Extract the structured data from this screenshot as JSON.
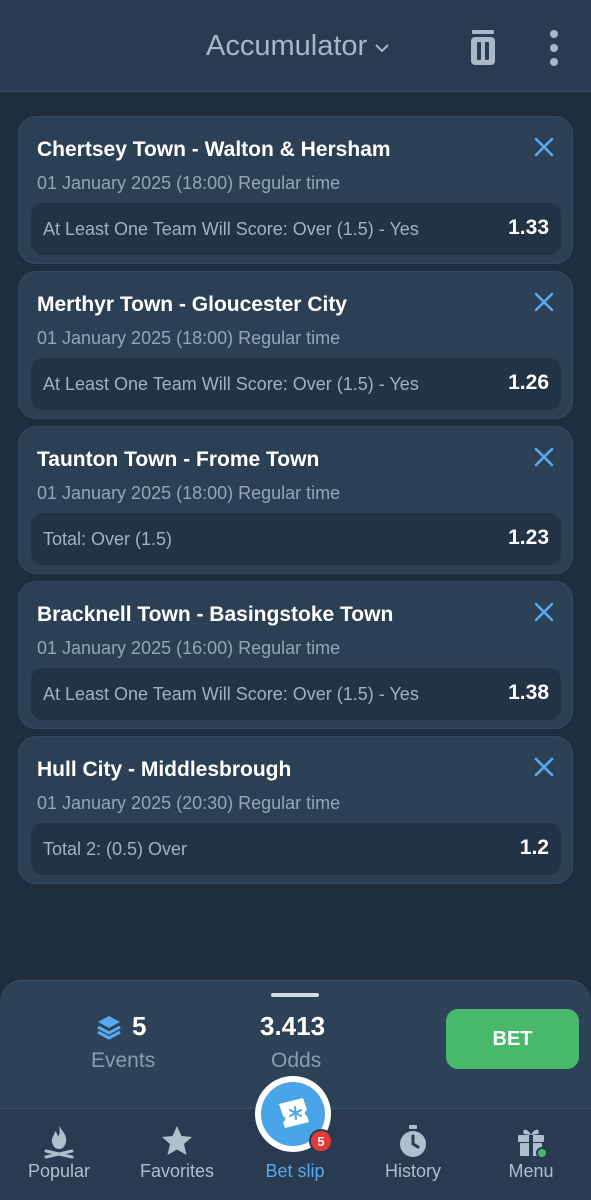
{
  "header": {
    "title": "Accumulator"
  },
  "bets": [
    {
      "match": "Chertsey Town - Walton & Hersham",
      "datetime": "01 January 2025 (18:00) Regular time",
      "market": "At Least One Team Will Score: Over (1.5) - Yes",
      "odds": "1.33"
    },
    {
      "match": "Merthyr Town - Gloucester City",
      "datetime": "01 January 2025 (18:00) Regular time",
      "market": "At Least One Team Will Score: Over (1.5) - Yes",
      "odds": "1.26"
    },
    {
      "match": "Taunton Town - Frome Town",
      "datetime": "01 January 2025 (18:00) Regular time",
      "market": "Total: Over (1.5)",
      "odds": "1.23"
    },
    {
      "match": "Bracknell Town - Basingstoke Town",
      "datetime": "01 January 2025 (16:00) Regular time",
      "market": "At Least One Team Will Score: Over (1.5) - Yes",
      "odds": "1.38"
    },
    {
      "match": "Hull City - Middlesbrough",
      "datetime": "01 January 2025 (20:30) Regular time",
      "market": "Total 2: (0.5) Over",
      "odds": "1.2"
    }
  ],
  "summary": {
    "events_count": "5",
    "events_label": "Events",
    "odds_value": "3.413",
    "odds_label": "Odds",
    "bet_label": "BET"
  },
  "nav": {
    "items": [
      {
        "label": "Popular",
        "icon": "campfire-icon"
      },
      {
        "label": "Favorites",
        "icon": "star-icon"
      },
      {
        "label": "Bet slip",
        "icon": "ticket-icon"
      },
      {
        "label": "History",
        "icon": "stopwatch-icon"
      },
      {
        "label": "Menu",
        "icon": "gift-icon"
      }
    ],
    "betslip_badge": "5"
  },
  "colors": {
    "accent": "#5aa9f0",
    "bet_button": "#48b86a",
    "badge": "#e53935",
    "background": "#1f2e3e"
  }
}
